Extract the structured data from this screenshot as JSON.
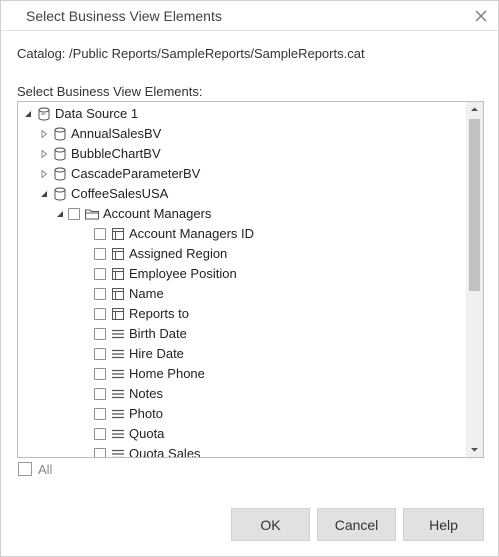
{
  "dialog": {
    "title": "Select Business View Elements",
    "catalog_text": "Catalog: /Public Reports/SampleReports/SampleReports.cat",
    "tree_label": "Select Business View Elements:",
    "all_label": "All",
    "buttons": {
      "ok": "OK",
      "cancel": "Cancel",
      "help": "Help"
    }
  },
  "tree": [
    {
      "label": "Data Source 1",
      "level": 0,
      "toggle": "expanded",
      "checkbox": false,
      "icon": "datasource-icon"
    },
    {
      "label": "AnnualSalesBV",
      "level": 1,
      "toggle": "collapsed",
      "checkbox": false,
      "icon": "business-view-icon"
    },
    {
      "label": "BubbleChartBV",
      "level": 1,
      "toggle": "collapsed",
      "checkbox": false,
      "icon": "business-view-icon"
    },
    {
      "label": "CascadeParameterBV",
      "level": 1,
      "toggle": "collapsed",
      "checkbox": false,
      "icon": "business-view-icon"
    },
    {
      "label": "CoffeeSalesUSA",
      "level": 1,
      "toggle": "expanded",
      "checkbox": false,
      "icon": "business-view-icon"
    },
    {
      "label": "Account Managers",
      "level": 2,
      "toggle": "expanded",
      "checkbox": true,
      "icon": "folder-icon"
    },
    {
      "label": "Account Managers ID",
      "level": 3,
      "toggle": "none",
      "checkbox": true,
      "icon": "group-field-icon"
    },
    {
      "label": "Assigned Region",
      "level": 3,
      "toggle": "none",
      "checkbox": true,
      "icon": "group-field-icon"
    },
    {
      "label": "Employee Position",
      "level": 3,
      "toggle": "none",
      "checkbox": true,
      "icon": "group-field-icon"
    },
    {
      "label": "Name",
      "level": 3,
      "toggle": "none",
      "checkbox": true,
      "icon": "group-field-icon"
    },
    {
      "label": "Reports to",
      "level": 3,
      "toggle": "none",
      "checkbox": true,
      "icon": "group-field-icon"
    },
    {
      "label": "Birth Date",
      "level": 3,
      "toggle": "none",
      "checkbox": true,
      "icon": "detail-field-icon"
    },
    {
      "label": "Hire Date",
      "level": 3,
      "toggle": "none",
      "checkbox": true,
      "icon": "detail-field-icon"
    },
    {
      "label": "Home Phone",
      "level": 3,
      "toggle": "none",
      "checkbox": true,
      "icon": "detail-field-icon"
    },
    {
      "label": "Notes",
      "level": 3,
      "toggle": "none",
      "checkbox": true,
      "icon": "detail-field-icon"
    },
    {
      "label": "Photo",
      "level": 3,
      "toggle": "none",
      "checkbox": true,
      "icon": "detail-field-icon"
    },
    {
      "label": "Quota",
      "level": 3,
      "toggle": "none",
      "checkbox": true,
      "icon": "detail-field-icon"
    },
    {
      "label": "Quota Sales",
      "level": 3,
      "toggle": "none",
      "checkbox": true,
      "icon": "detail-field-icon"
    }
  ]
}
